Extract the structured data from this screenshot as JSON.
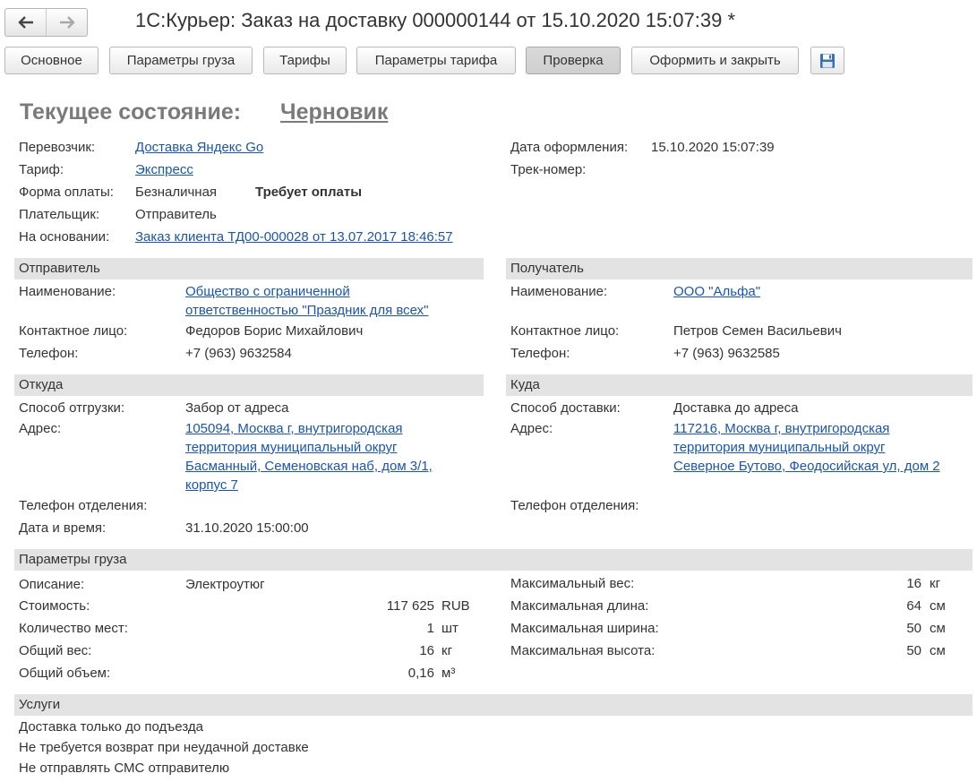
{
  "window": {
    "title": "1С:Курьер: Заказ на доставку 000000144 от 15.10.2020 15:07:39 *"
  },
  "toolbar": {
    "tabs": [
      "Основное",
      "Параметры груза",
      "Тарифы",
      "Параметры тарифа",
      "Проверка",
      "Оформить и закрыть"
    ],
    "save_icon": "floppy-disk-icon"
  },
  "state": {
    "label": "Текущее состояние:",
    "value": "Черновик"
  },
  "header": {
    "carrier_label": "Перевозчик:",
    "carrier": "Доставка Яндекс Go",
    "tariff_label": "Тариф:",
    "tariff": "Экспресс",
    "payment_label": "Форма оплаты:",
    "payment": "Безналичная",
    "payment_status": "Требует оплаты",
    "payer_label": "Плательщик:",
    "payer": "Отправитель",
    "basis_label": "На основании:",
    "basis": "Заказ клиента ТД00-000028 от 13.07.2017 18:46:57",
    "date_label": "Дата оформления:",
    "date": "15.10.2020 15:07:39",
    "track_label": "Трек-номер:"
  },
  "sender": {
    "section": "Отправитель",
    "name_label": "Наименование:",
    "name_line1": "Общество с ограниченной ",
    "name_line2": "ответственностью \"Праздник для всех\"",
    "contact_label": "Контактное лицо:",
    "contact": "Федоров Борис Михайлович",
    "phone_label": "Телефон:",
    "phone": "+7 (963) 9632584"
  },
  "recipient": {
    "section": "Получатель",
    "name_label": "Наименование:",
    "name": "ООО \"Альфа\"",
    "contact_label": "Контактное лицо:",
    "contact": "Петров Семен Васильевич",
    "phone_label": "Телефон:",
    "phone": "+7 (963) 9632585"
  },
  "from": {
    "section": "Откуда",
    "method_label": "Способ отгрузки:",
    "method": "Забор от адреса",
    "address_label": "Адрес:",
    "address_lines": [
      "105094, Москва г, внутригородская ",
      "территория муниципальный округ ",
      "Басманный, Семеновская наб, дом 3/1, ",
      "корпус 7"
    ],
    "branch_phone_label": "Телефон отделения:",
    "datetime_label": "Дата и время:",
    "datetime": "31.10.2020 15:00:00"
  },
  "to": {
    "section": "Куда",
    "method_label": "Способ доставки:",
    "method": "Доставка до адреса",
    "address_label": "Адрес:",
    "address_lines": [
      "117216, Москва г, внутригородская ",
      "территория муниципальный округ ",
      "Северное Бутово, Феодосийская ул, дом 2"
    ],
    "branch_phone_label": "Телефон отделения:"
  },
  "cargo": {
    "section": "Параметры груза",
    "description_label": "Описание:",
    "description": "Электроутюг",
    "cost_label": "Стоимость:",
    "cost": "117 625",
    "cost_unit": "RUB",
    "places_label": "Количество мест:",
    "places": "1",
    "places_unit": "шт",
    "weight_label": "Общий вес:",
    "weight": "16",
    "weight_unit": "кг",
    "volume_label": "Общий объем:",
    "volume": "0,16",
    "volume_unit": "м³",
    "max_weight_label": "Максимальный вес:",
    "max_weight": "16",
    "max_weight_unit": "кг",
    "max_length_label": "Максимальная длина:",
    "max_length": "64",
    "max_length_unit": "см",
    "max_width_label": "Максимальная ширина:",
    "max_width": "50",
    "max_width_unit": "см",
    "max_height_label": "Максимальная высота:",
    "max_height": "50",
    "max_height_unit": "см"
  },
  "services": {
    "section": "Услуги",
    "items": [
      "Доставка только до подъезда",
      "Не требуется возврат при неудачной доставке",
      "Не отправлять СМС отправителю"
    ]
  }
}
